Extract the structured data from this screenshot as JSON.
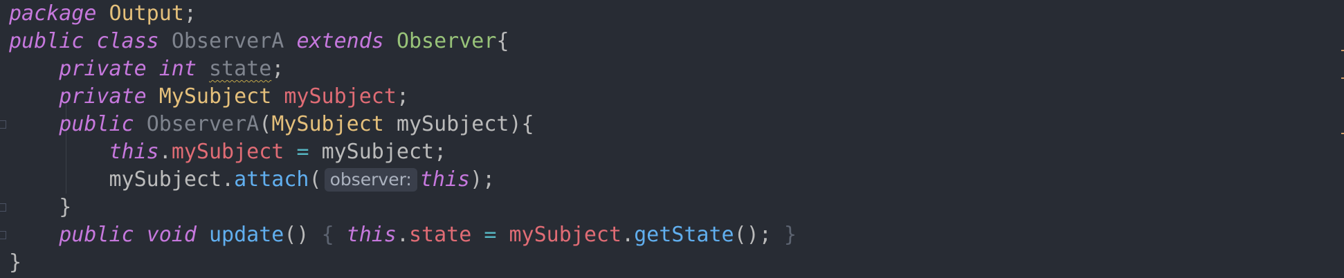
{
  "code": {
    "line1": {
      "kw_package": "package",
      "pkg_name": "Output",
      "semicolon": ";"
    },
    "line2": {
      "kw_public": "public",
      "kw_class": "class",
      "class_name": "ObserverA",
      "kw_extends": "extends",
      "parent": "Observer",
      "brace": "{"
    },
    "line3": {
      "kw_private": "private",
      "kw_int": "int",
      "field": "state",
      "semicolon": ";"
    },
    "line4": {
      "kw_private": "private",
      "type": "MySubject",
      "field": "mySubject",
      "semicolon": ";"
    },
    "line5": {
      "kw_public": "public",
      "ctor": "ObserverA",
      "paren_open": "(",
      "param_type": "MySubject",
      "param": "mySubject",
      "close": "){"
    },
    "line6": {
      "kw_this": "this",
      "dot": ".",
      "field": "mySubject",
      "assign": "=",
      "value": "mySubject",
      "semicolon": ";"
    },
    "line7": {
      "receiver": "mySubject",
      "dot": ".",
      "method": "attach",
      "paren_open": "(",
      "hint": "observer:",
      "kw_this": "this",
      "close": ");"
    },
    "line8": {
      "brace": "}"
    },
    "line9": {
      "kw_public": "public",
      "kw_void": "void",
      "method": "update",
      "parens": "()",
      "brace_open": "{",
      "kw_this": "this",
      "dot": ".",
      "field": "state",
      "assign": "=",
      "receiver": "mySubject",
      "dot2": ".",
      "call": "getState",
      "call_close": "();",
      "brace_close": "}"
    },
    "line10": {
      "brace": "}"
    }
  }
}
